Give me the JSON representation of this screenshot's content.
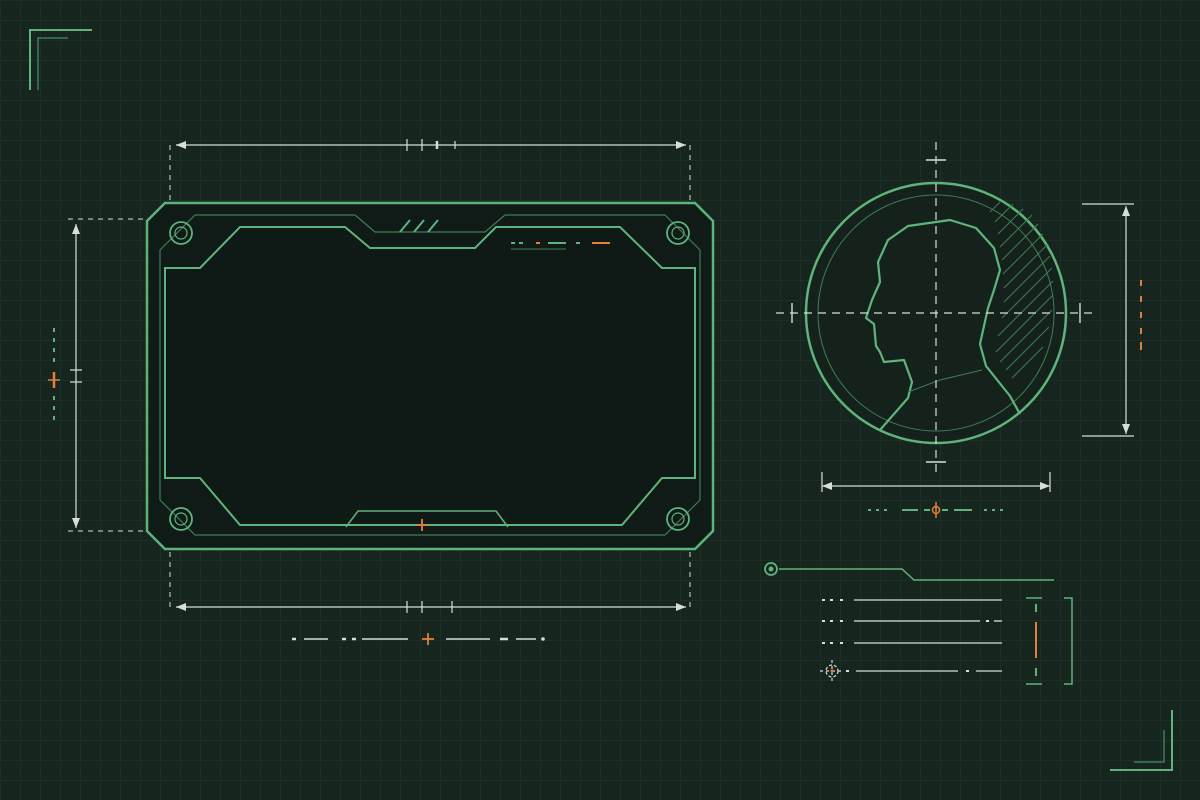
{
  "colors": {
    "background": "#17251f",
    "grid_line": "#22362d",
    "panel_fill": "#101a16",
    "accent_green": "#5fb37c",
    "accent_green_dim": "#3f7d57",
    "dimension_line": "#d9ded8",
    "accent_orange": "#e0803a"
  },
  "icons": {
    "profile": "person-silhouette-icon",
    "crosshair": "crosshair-icon",
    "target": "target-reticle-icon",
    "bolt": "corner-bolt-icon"
  },
  "display_frame": {
    "text": ""
  },
  "profile_circle": {
    "text": ""
  },
  "data_list": {
    "rows": 4
  }
}
